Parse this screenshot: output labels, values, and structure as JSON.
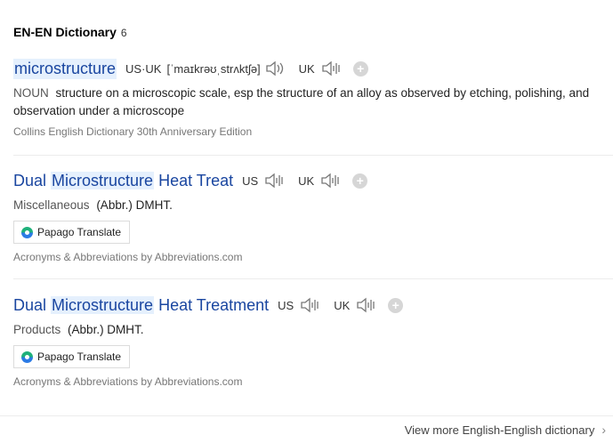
{
  "section": {
    "title": "EN-EN Dictionary",
    "count": "6"
  },
  "entries": [
    {
      "headword": "microstructure",
      "pron_combined_label": "US·UK",
      "ipa": "[ˈmaɪkrəʊˌstrʌktʃə]",
      "uk_label": "UK",
      "pos": "NOUN",
      "definition": "structure on a microscopic scale, esp the structure of an alloy as observed by etching, polishing, and observation under a microscope",
      "source": "Collins English Dictionary 30th Anniversary Edition"
    },
    {
      "headword_before": "Dual ",
      "headword_highlight": "Microstructure",
      "headword_after": " Heat Treat",
      "us_label": "US",
      "uk_label": "UK",
      "pos": "Miscellaneous",
      "definition": "(Abbr.) DMHT.",
      "translate_button": "Papago Translate",
      "source": "Acronyms & Abbreviations by Abbreviations.com"
    },
    {
      "headword_before": "Dual ",
      "headword_highlight": "Microstructure",
      "headword_after": " Heat Treatment",
      "us_label": "US",
      "uk_label": "UK",
      "pos": "Products",
      "definition": "(Abbr.) DMHT.",
      "translate_button": "Papago Translate",
      "source": "Acronyms & Abbreviations by Abbreviations.com"
    }
  ],
  "footer": {
    "more_link": "View more English-English dictionary"
  },
  "icons": {
    "speaker": "speaker-icon",
    "add": "plus-circle-icon",
    "papago": "papago-logo-icon",
    "chevron": "chevron-right-icon"
  },
  "colors": {
    "link": "#1a46a0",
    "highlight": "#e5f0fd"
  }
}
